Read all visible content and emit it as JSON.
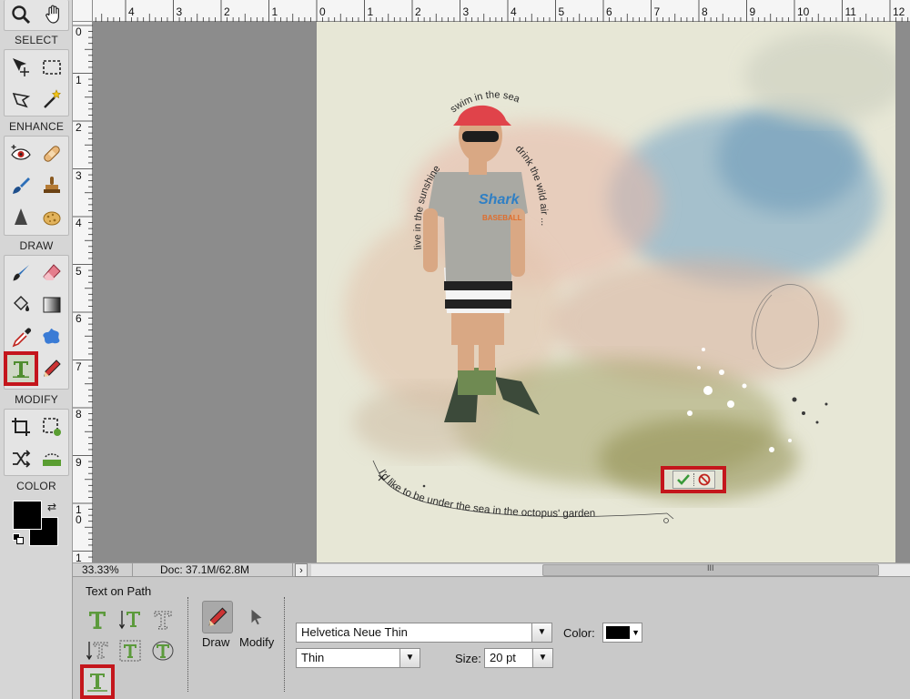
{
  "toolbox": {
    "sections": {
      "select": "SELECT",
      "enhance": "ENHANCE",
      "draw": "DRAW",
      "modify": "MODIFY",
      "color": "COLOR"
    },
    "foreground_color": "#000000",
    "background_color": "#000000",
    "highlight_color": "#c4161c"
  },
  "rulers": {
    "top_labels": [
      "4",
      "3",
      "2",
      "1",
      "0",
      "1",
      "2",
      "3",
      "4",
      "5",
      "6",
      "7",
      "8",
      "9",
      "10",
      "11",
      "12"
    ],
    "left_labels": [
      "0",
      "1",
      "2",
      "3",
      "4",
      "5",
      "6",
      "7",
      "8",
      "9",
      "1\n0",
      "1"
    ]
  },
  "canvas": {
    "path_text_top_left": "live in the sunshine",
    "path_text_top": "swim in the sea",
    "path_text_top_right": "drink the wild air ...",
    "path_text_bottom": "I'd like to be under the sea in the octopus' garden",
    "shirt_text": "Shark",
    "shirt_subtext": "BASEBALL"
  },
  "status": {
    "zoom": "33.33%",
    "doc": "Doc: 37.1M/62.8M",
    "arrow": "›",
    "grip": "III"
  },
  "options": {
    "title": "Text on Path",
    "mode_draw": "Draw",
    "mode_modify": "Modify",
    "font_family": "Helvetica Neue Thin",
    "font_style": "Thin",
    "size_label": "Size:",
    "size_value": "20 pt",
    "color_label": "Color:",
    "text_color": "#000000"
  }
}
